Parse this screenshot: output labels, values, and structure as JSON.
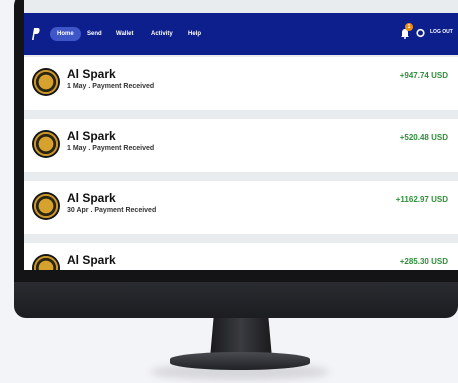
{
  "nav": {
    "items": [
      {
        "label": "Home"
      },
      {
        "label": "Send"
      },
      {
        "label": "Wallet"
      },
      {
        "label": "Activity"
      },
      {
        "label": "Help"
      }
    ],
    "notification_count": "1",
    "logout_label": "LOG OUT",
    "colors": {
      "bar": "#0d1f8c",
      "active_pill": "#3f56c8",
      "badge": "#e98d12"
    }
  },
  "transactions": [
    {
      "name": "Al Spark",
      "date": "1 May",
      "description": "Payment Received",
      "subtitle": "1 May . Payment Received",
      "amount": "+947.74 USD",
      "icon": "coin-avatar-icon"
    },
    {
      "name": "Al Spark",
      "date": "1 May",
      "description": "Payment Received",
      "subtitle": "1 May . Payment Received",
      "amount": "+520.48 USD",
      "icon": "coin-avatar-icon"
    },
    {
      "name": "Al Spark",
      "date": "30 Apr",
      "description": "Payment Received",
      "subtitle": "30 Apr . Payment Received",
      "amount": "+1162.97 USD",
      "icon": "coin-avatar-icon"
    },
    {
      "name": "Al Spark",
      "date": "",
      "description": "",
      "subtitle": "",
      "amount": "+285.30 USD",
      "icon": "coin-avatar-icon"
    }
  ],
  "amount_color": "#2f8f3a"
}
